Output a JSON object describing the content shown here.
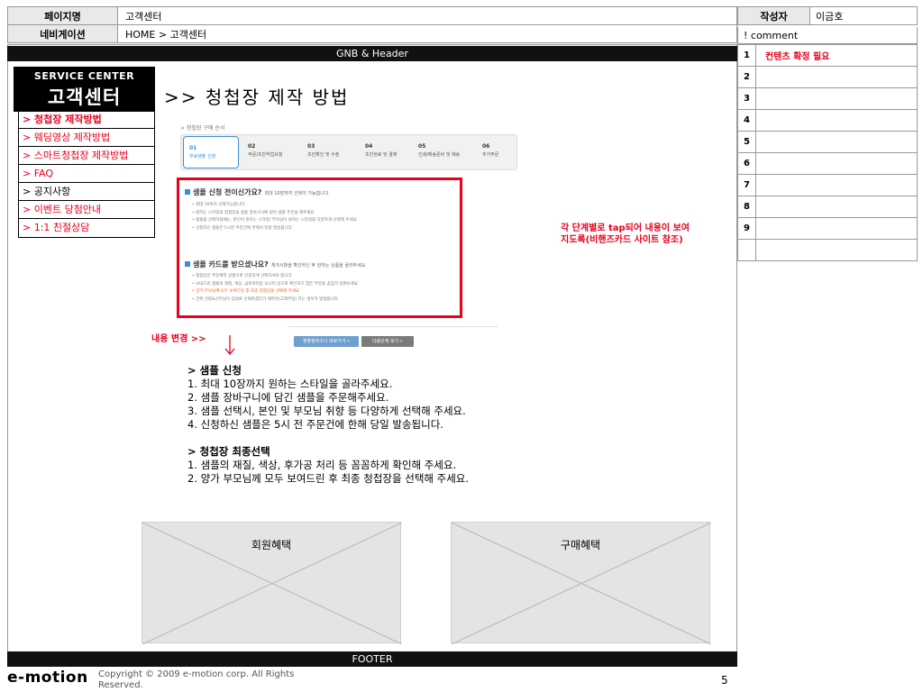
{
  "header": {
    "page_name_label": "페이지명",
    "page_name": "고객센터",
    "nav_label": "네비게이션",
    "nav_path": "HOME > 고객센터",
    "author_label": "작성자",
    "author": "이금호"
  },
  "comments": {
    "header": "! comment",
    "items": [
      {
        "num": "1",
        "text": "컨텐츠 확정 필요"
      },
      {
        "num": "2",
        "text": ""
      },
      {
        "num": "3",
        "text": ""
      },
      {
        "num": "4",
        "text": ""
      },
      {
        "num": "5",
        "text": ""
      },
      {
        "num": "6",
        "text": ""
      },
      {
        "num": "7",
        "text": ""
      },
      {
        "num": "8",
        "text": ""
      },
      {
        "num": "9",
        "text": ""
      }
    ]
  },
  "gnb": "GNB & Header",
  "sidebar": {
    "title_en": "SERVICE CENTER",
    "title_ko": "고객센터",
    "items": [
      {
        "label": "> 청첩장 제작방법"
      },
      {
        "label": "> 웨딩영상 제작방법"
      },
      {
        "label": "> 스마트청첩장 제작방법"
      },
      {
        "label": "> FAQ"
      },
      {
        "label": "> 공지사항"
      },
      {
        "label": "> 이벤트 당첨안내"
      },
      {
        "label": "> 1:1 친절상담"
      }
    ]
  },
  "page_title": ">> 청첩장 제작 방법",
  "screenshot": {
    "breadcrumb": "> 청첩장 구매 순서",
    "steps": [
      {
        "num": "01",
        "label": "무료샘플 신청"
      },
      {
        "num": "02",
        "label": "주문/초안작업요청"
      },
      {
        "num": "03",
        "label": "초안확인 및 수정"
      },
      {
        "num": "04",
        "label": "초안완료 및 결제"
      },
      {
        "num": "05",
        "label": "인쇄/배송준비 및 배송"
      },
      {
        "num": "06",
        "label": "추가주문"
      }
    ],
    "section1_title": "샘플 신청 전이신가요?",
    "section1_sub": "최대 10장까지 선택이 가능합니다",
    "section1_bullets": [
      "• 최대 10까지 선택가능합니다.",
      "• 원하는 스타일의 청첩장을 샘플 장바구니에 담아 샘플 주문을 해주세요",
      "• 샘플을 선택하실때는, 본인이 원하는 스타일/ 부모님이 원하는 스타일을 다양하게 선택해 주세요",
      "• 신청하신 샘플은 5시전 주문건에 한해서 당일 발송됩니다."
    ],
    "section2_title": "샘플 카드를 받으셨나요?",
    "section2_sub": "체크사항을 확인하신 후 원하는 상품을 골라주세요",
    "section2_bullets": [
      "• 청첩장은 주문제작 상품으로 신중하게 선택하셔야 합니다",
      "• 보내드린 샘플의 재질, 색상, 금박처리등 모니터 상으로 확인하기 힘든 부분을 꼼꼼히 살펴보세요",
      "• 양가 부모님께 모두 보여드린 후 최종 청첩장을 선택해 주세요",
      "• 간혹 신랑&신부님이 임의로 선택하셨다가 재주문(고객부담) 하는 경우가 발생합니다"
    ],
    "btn_cart": "샘플장바구니 바로가기 »",
    "btn_next": "다음단계 보기 »"
  },
  "note_right": [
    "각 단계별로 tap되어 내용이 보여",
    "지도록(비핸즈카드 사이트 참조)"
  ],
  "change_label": "내용 변경 >>",
  "content": {
    "section1_title": "> 샘플 신청",
    "section1_items": [
      "1. 최대 10장까지 원하는 스타일을 골라주세요.",
      "2. 샘플 장바구니에 담긴 샘플을 주문해주세요.",
      "3. 샘플 선택시, 본인 및 부모님 취향 등 다양하게 선택해 주세요.",
      "4. 신청하신 샘플은 5시 전 주문건에 한해 당일 발송됩니다."
    ],
    "section2_title": "> 청첩장 최종선택",
    "section2_items": [
      "1. 샘플의 재질, 색상, 후가공 처리 등 꼼꼼하게 확인해 주세요.",
      "2. 양가 부모님께 모두 보여드린 후 최종 청첩장을 선택해 주세요."
    ]
  },
  "placeholders": {
    "member": "회원혜택",
    "purchase": "구매혜택"
  },
  "footer": "FOOTER",
  "brand": "e-motion",
  "copyright": "Copyright © 2009 e-motion corp. All Rights Reserved.",
  "page_number": "5",
  "colors": {
    "accent_red": "#e8001c",
    "step_blue": "#3d8fd1",
    "bar_black": "#111111"
  }
}
